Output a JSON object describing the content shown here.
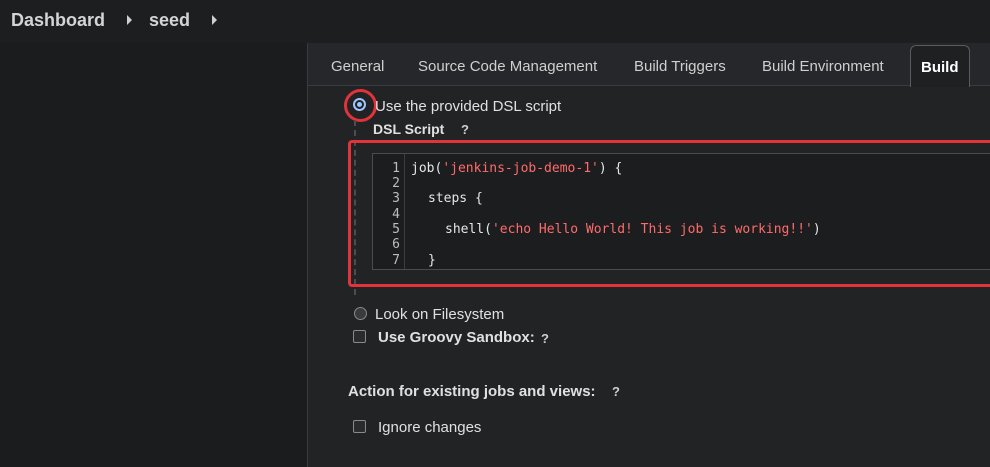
{
  "breadcrumb": {
    "items": [
      "Dashboard",
      "seed"
    ]
  },
  "tabs": [
    "General",
    "Source Code Management",
    "Build Triggers",
    "Build Environment",
    "Build"
  ],
  "dsl": {
    "option_provided": "Use the provided DSL script",
    "script_label": "DSL Script",
    "help": "?",
    "lines": {
      "n1": "1",
      "n2": "2",
      "n3": "3",
      "n4": "4",
      "n5": "5",
      "n6": "6",
      "n7": "7",
      "l1_a": "job(",
      "l1_s": "'jenkins-job-demo-1'",
      "l1_b": ") {",
      "l3": "steps {",
      "l5_a": "shell(",
      "l5_s": "'echo Hello World! This job is working!!'",
      "l5_b": ")",
      "l7": "}"
    },
    "option_filesystem": "Look on Filesystem",
    "sandbox_label": "Use Groovy Sandbox:",
    "action_label": "Action for existing jobs and views:",
    "ignore_label": "Ignore changes"
  },
  "colors": {
    "highlight": "#e0333a",
    "string": "#ff6b6b",
    "radio": "#9fc6ff"
  }
}
